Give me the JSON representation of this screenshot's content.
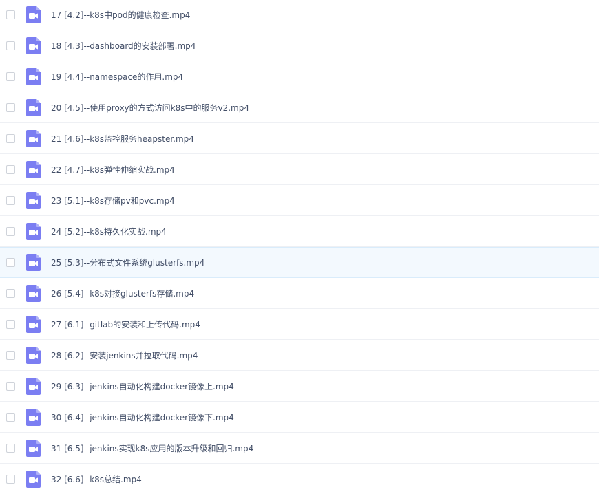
{
  "colors": {
    "icon": "#7b7ef2",
    "icon_fold": "#aeb0f8",
    "row_hover": "#f3f9fe",
    "text": "#424e67"
  },
  "files": [
    {
      "name": "17 [4.2]--k8s中pod的健康检查.mp4",
      "icon": "video-file-icon"
    },
    {
      "name": "18 [4.3]--dashboard的安装部署.mp4",
      "icon": "video-file-icon"
    },
    {
      "name": "19 [4.4]--namespace的作用.mp4",
      "icon": "video-file-icon"
    },
    {
      "name": "20 [4.5]--使用proxy的方式访问k8s中的服务v2.mp4",
      "icon": "video-file-icon"
    },
    {
      "name": "21 [4.6]--k8s监控服务heapster.mp4",
      "icon": "video-file-icon"
    },
    {
      "name": "22 [4.7]--k8s弹性伸缩实战.mp4",
      "icon": "video-file-icon"
    },
    {
      "name": "23 [5.1]--k8s存储pv和pvc.mp4",
      "icon": "video-file-icon"
    },
    {
      "name": "24 [5.2]--k8s持久化实战.mp4",
      "icon": "video-file-icon"
    },
    {
      "name": "25 [5.3]--分布式文件系统glusterfs.mp4",
      "icon": "video-file-icon",
      "hovered": true
    },
    {
      "name": "26 [5.4]--k8s对接glusterfs存储.mp4",
      "icon": "video-file-icon"
    },
    {
      "name": "27 [6.1]--gitlab的安装和上传代码.mp4",
      "icon": "video-file-icon"
    },
    {
      "name": "28 [6.2]--安装jenkins并拉取代码.mp4",
      "icon": "video-file-icon"
    },
    {
      "name": "29 [6.3]--jenkins自动化构建docker镜像上.mp4",
      "icon": "video-file-icon"
    },
    {
      "name": "30 [6.4]--jenkins自动化构建docker镜像下.mp4",
      "icon": "video-file-icon"
    },
    {
      "name": "31 [6.5]--jenkins实现k8s应用的版本升级和回归.mp4",
      "icon": "video-file-icon"
    },
    {
      "name": "32 [6.6]--k8s总结.mp4",
      "icon": "video-file-icon"
    }
  ]
}
